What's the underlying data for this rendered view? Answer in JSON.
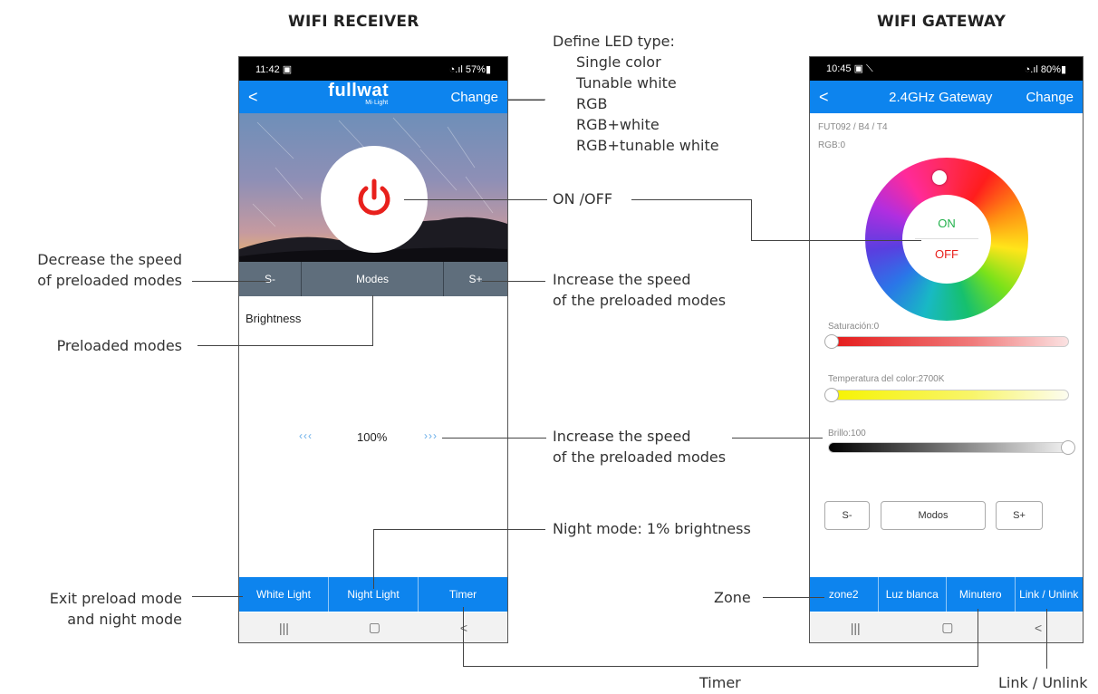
{
  "left_phone": {
    "heading": "WIFI RECEIVER",
    "status_time": "11:42",
    "status_right": "57%",
    "brand": "fullwat",
    "brand_sub": "Mi·Light",
    "change_label": "Change",
    "speed_bar": {
      "minus": "S-",
      "modes": "Modes",
      "plus": "S+"
    },
    "brightness_label": "Brightness",
    "brightness_value": "100%",
    "arrow_left": "‹‹‹",
    "arrow_right": "›››",
    "bottom_tabs": [
      "White Light",
      "Night Light",
      "Timer"
    ],
    "nav": [
      "|||",
      "▢",
      "<"
    ]
  },
  "right_phone": {
    "heading": "WIFI GATEWAY",
    "status_time": "10:45",
    "status_right": "80%",
    "title": "2.4GHz Gateway",
    "change_label": "Change",
    "device_info": "FUT092 / B4 / T4",
    "rgb_info": "RGB:0",
    "on_label": "ON",
    "off_label": "OFF",
    "saturation_label": "Saturación:0",
    "temperature_label": "Temperatura del color:2700K",
    "brightness_label": "Brillo:100",
    "speed_buttons": {
      "minus": "S-",
      "modes": "Modos",
      "plus": "S+"
    },
    "bottom_tabs": [
      "zone2",
      "Luz blanca",
      "Minutero",
      "Link / Unlink"
    ],
    "nav": [
      "|||",
      "▢",
      "<"
    ]
  },
  "annotations": {
    "define_led_title": "Define LED type:",
    "led_types": [
      "Single color",
      "Tunable white",
      "RGB",
      "RGB+white",
      "RGB+tunable white"
    ],
    "on_off": "ON /OFF",
    "decrease_speed": [
      "Decrease the speed",
      "of preloaded modes"
    ],
    "increase_speed_1": [
      "Increase the speed",
      "of the preloaded modes"
    ],
    "preloaded_modes": "Preloaded modes",
    "increase_speed_2": [
      "Increase the speed",
      "of the preloaded modes"
    ],
    "night_mode": "Night mode: 1% brightness",
    "exit_preload": [
      "Exit preload mode",
      "and night mode"
    ],
    "zone": "Zone",
    "timer": "Timer",
    "link_unlink": "Link / Unlink"
  },
  "colors": {
    "accent_blue": "#0d84ee",
    "power_red": "#e8201c",
    "on_green": "#22b14c",
    "off_red": "#e8201c",
    "speed_bar_gray": "#5f6e7c"
  }
}
